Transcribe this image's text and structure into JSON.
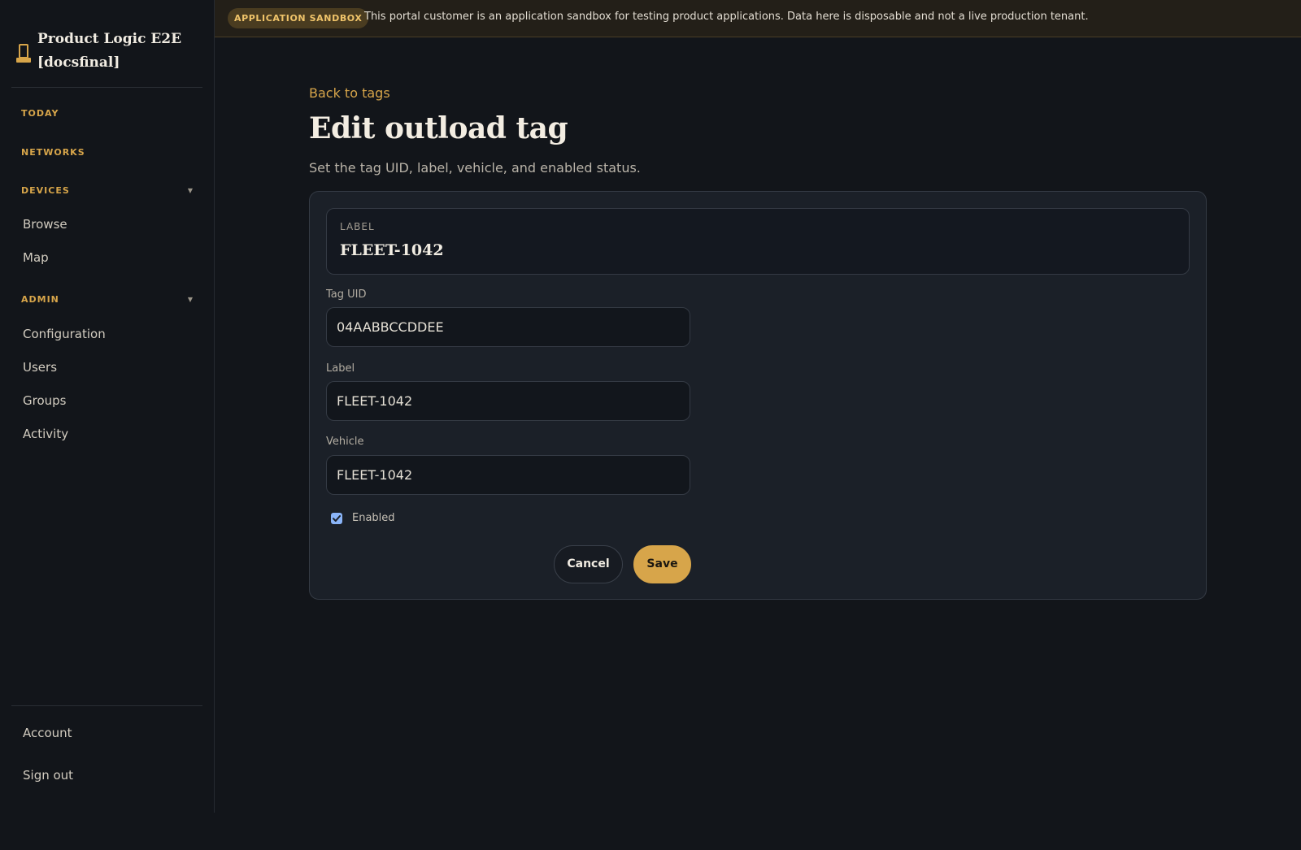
{
  "sidebar": {
    "brand_title": "Product Logic E2E [docsfinal]",
    "brand_icon": "stamp-icon",
    "sections": {
      "today": "TODAY",
      "networks": "NETWORKS",
      "devices": "DEVICES",
      "admin": "ADMIN"
    },
    "devices_items": [
      "Browse",
      "Map"
    ],
    "admin_items": [
      "Configuration",
      "Users",
      "Groups",
      "Activity"
    ],
    "footer_items": [
      "Account",
      "Sign out"
    ],
    "accent_color": "#d7a54a"
  },
  "banner": {
    "badge": "APPLICATION SANDBOX",
    "text": "This portal customer is an application sandbox for testing product applications. Data here is disposable and not a live production tenant."
  },
  "page": {
    "back_link": "Back to tags",
    "title": "Edit outload tag",
    "subtitle": "Set the tag UID, label, vehicle, and enabled status."
  },
  "form": {
    "preview_label": "LABEL",
    "preview_value": "FLEET-1042",
    "tag_uid_label": "Tag UID",
    "tag_uid_value": "04AABBCCDDEE",
    "label_label": "Label",
    "label_value": "FLEET-1042",
    "vehicle_label": "Vehicle",
    "vehicle_value": "FLEET-1042",
    "enabled_label": "Enabled",
    "enabled_checked": true,
    "cancel_label": "Cancel",
    "save_label": "Save"
  }
}
